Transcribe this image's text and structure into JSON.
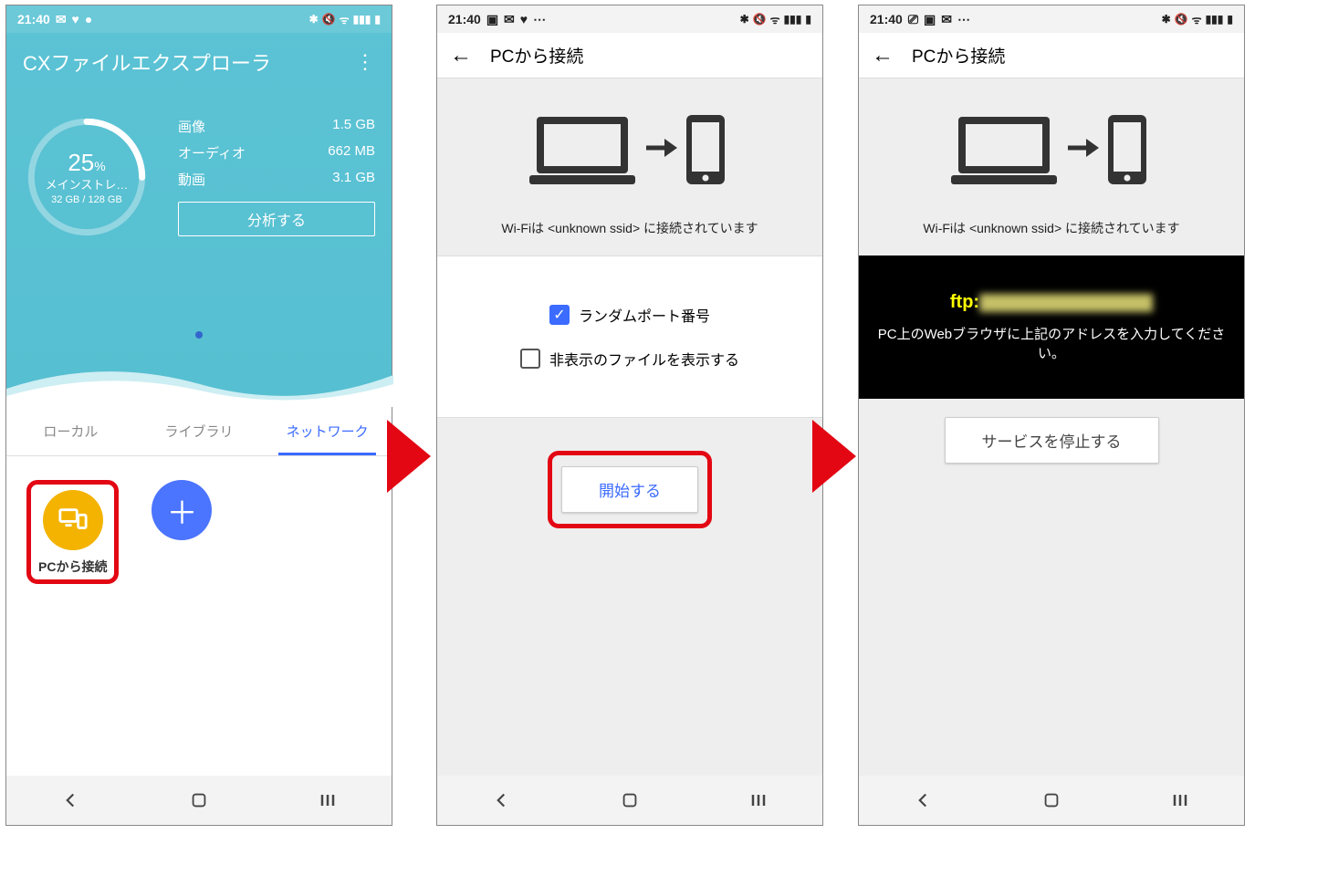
{
  "status": {
    "time": "21:40"
  },
  "phone1": {
    "appTitle": "CXファイルエクスプローラ",
    "storage": {
      "percent": "25",
      "percentSuffix": "%",
      "label": "メインストレ…",
      "capacity": "32 GB / 128 GB"
    },
    "stats": {
      "imageLabel": "画像",
      "imageVal": "1.5 GB",
      "audioLabel": "オーディオ",
      "audioVal": "662 MB",
      "videoLabel": "動画",
      "videoVal": "3.1 GB"
    },
    "analyzeBtn": "分析する",
    "tabs": {
      "local": "ローカル",
      "library": "ライブラリ",
      "network": "ネットワーク"
    },
    "pcConnectLabel": "PCから接続"
  },
  "phone2": {
    "title": "PCから接続",
    "wifiLine": "Wi-Fiは <unknown ssid> に接続されています",
    "opt1": "ランダムポート番号",
    "opt2": "非表示のファイルを表示する",
    "startBtn": "開始する"
  },
  "phone3": {
    "title": "PCから接続",
    "wifiLine": "Wi-Fiは <unknown ssid> に接続されています",
    "ftpPrefix": "ftp:",
    "hint": "PC上のWebブラウザに上記のアドレスを入力してください。",
    "stopBtn": "サービスを停止する"
  }
}
